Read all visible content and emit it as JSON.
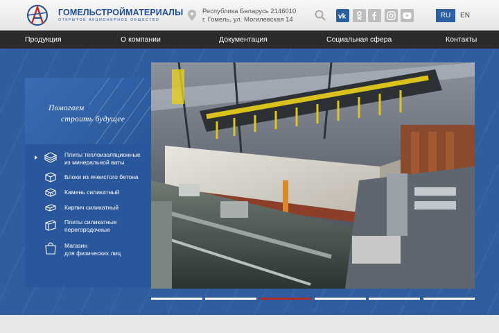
{
  "header": {
    "brand_name": "ГОМЕЛЬСТРОЙМАТЕРИАЛЫ",
    "brand_sub": "ОТКРЫТОЕ АКЦИОНЕРНОЕ ОБЩЕСТВО",
    "address_line1": "Республика Беларусь 2146010",
    "address_line2": "г. Гомель, ул. Могилевская 14",
    "social": [
      "vk-icon",
      "odnoklassniki-icon",
      "facebook-icon",
      "instagram-icon",
      "youtube-icon"
    ],
    "lang_ru": "RU",
    "lang_en": "EN"
  },
  "nav": {
    "items": [
      "Продукция",
      "О компании",
      "Документация",
      "Социальная сфера",
      "Контакты"
    ]
  },
  "slogan": {
    "line1": "Помогаем",
    "line2": "строить будущее"
  },
  "products": [
    {
      "label1": "Плиты теплоизоляционные",
      "label2": "из минеральной ваты",
      "icon": "stacked-slabs-icon",
      "active": true
    },
    {
      "label1": "Блоки из ячеистого бетона",
      "label2": "",
      "icon": "block-icon",
      "active": false
    },
    {
      "label1": "Камень силикатный",
      "label2": "",
      "icon": "brick-stone-icon",
      "active": false
    },
    {
      "label1": "Кирпич силикатный",
      "label2": "",
      "icon": "brick-icon",
      "active": false
    },
    {
      "label1": "Плиты силикатные",
      "label2": "перегородочные",
      "icon": "panel-icon",
      "active": false
    },
    {
      "label1": "Магазин",
      "label2": "для физических лиц",
      "icon": "shop-bag-icon",
      "active": false
    }
  ],
  "slider": {
    "count": 6,
    "active_index": 2
  },
  "colors": {
    "brand_blue": "#1f4d9a",
    "nav_bg": "#2b2b2b",
    "main_blue": "#2f5d9f",
    "active_dot": "#b22a2a"
  }
}
